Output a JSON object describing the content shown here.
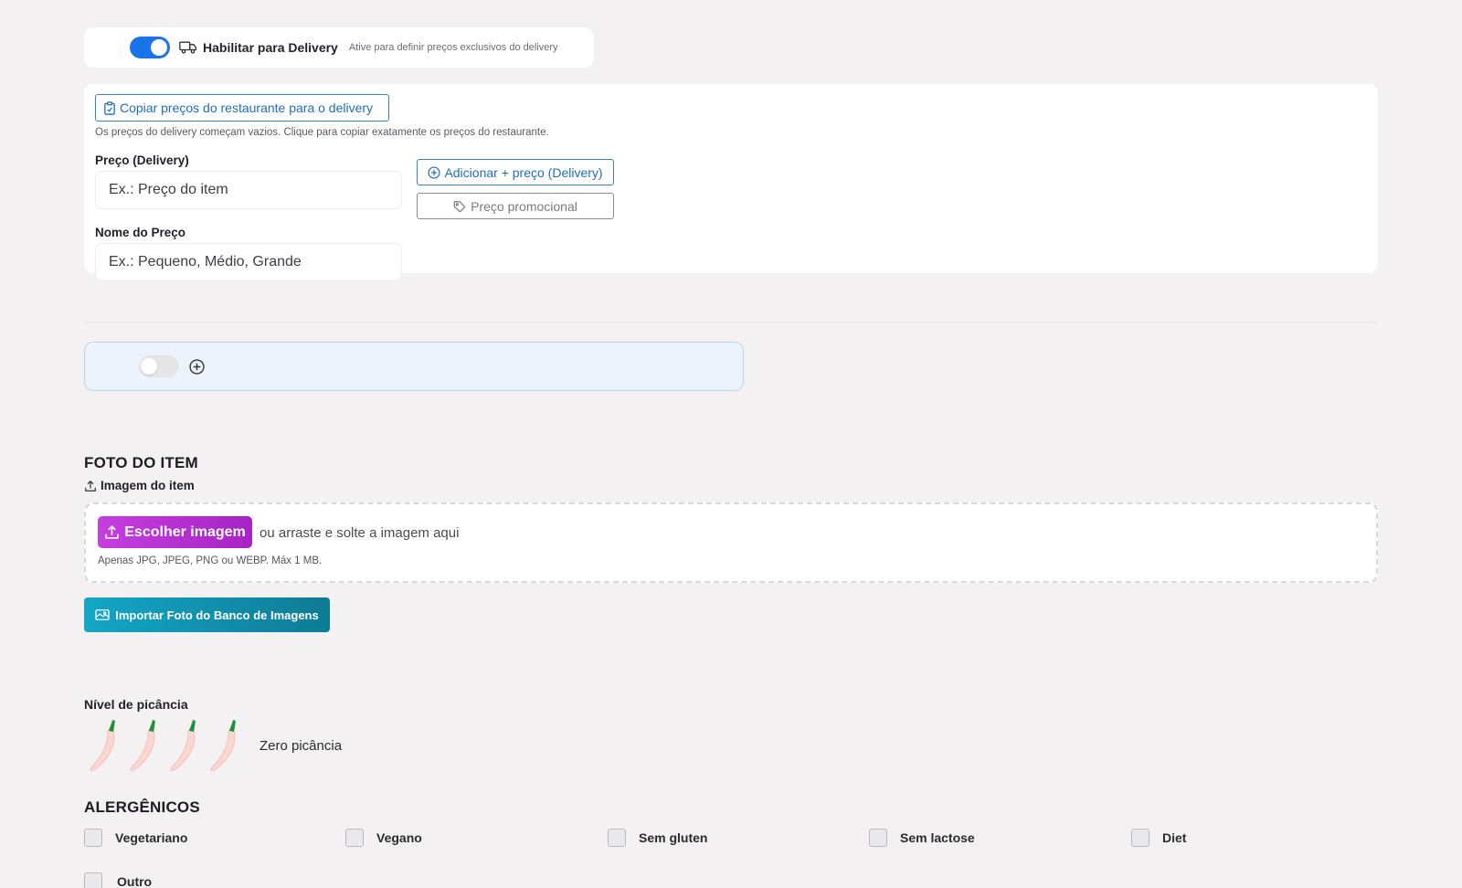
{
  "delivery": {
    "enabled": true,
    "title": "Habilitar para Delivery",
    "hint": "Ative para definir preços exclusivos do delivery",
    "toggle_icon": "truck-icon"
  },
  "prices": {
    "copy_button": "Copiar preços do restaurante para o delivery",
    "copy_hint": "Os preços do delivery começam vazios. Clique para copiar exatamente os preços do restaurante.",
    "price_label": "Preço (Delivery)",
    "price_placeholder": "Ex.: Preço do item",
    "name_label": "Nome do Preço",
    "name_placeholder": "Ex.: Pequeno, Médio, Grande",
    "add_button": "Adicionar + preço (Delivery)",
    "promo_button": "Preço promocional"
  },
  "extra_option": {
    "enabled": false
  },
  "photo": {
    "section_title": "FOTO DO ITEM",
    "image_label": "Imagem do item",
    "choose_button": "Escolher imagem",
    "drop_text": "ou arraste e solte a imagem aqui",
    "drop_hint": "Apenas JPG, JPEG, PNG ou WEBP. Máx 1 MB.",
    "import_button": "Importar Foto do Banco de Imagens"
  },
  "spice": {
    "label": "Nível de picância",
    "level": 0,
    "max": 4,
    "level_text": "Zero picância"
  },
  "allergens": {
    "section_title": "ALERGÊNICOS",
    "items": [
      {
        "label": "Vegetariano",
        "checked": false
      },
      {
        "label": "Vegano",
        "checked": false
      },
      {
        "label": "Sem gluten",
        "checked": false
      },
      {
        "label": "Sem lactose",
        "checked": false
      },
      {
        "label": "Diet",
        "checked": false
      },
      {
        "label": "Outro",
        "checked": false
      }
    ]
  },
  "colors": {
    "primary": "#1a73e8",
    "link": "#1e6fb8",
    "choose_gradient": [
      "#c63ee0",
      "#a623c4"
    ],
    "import_gradient": [
      "#14a6c8",
      "#0e7b94"
    ]
  }
}
